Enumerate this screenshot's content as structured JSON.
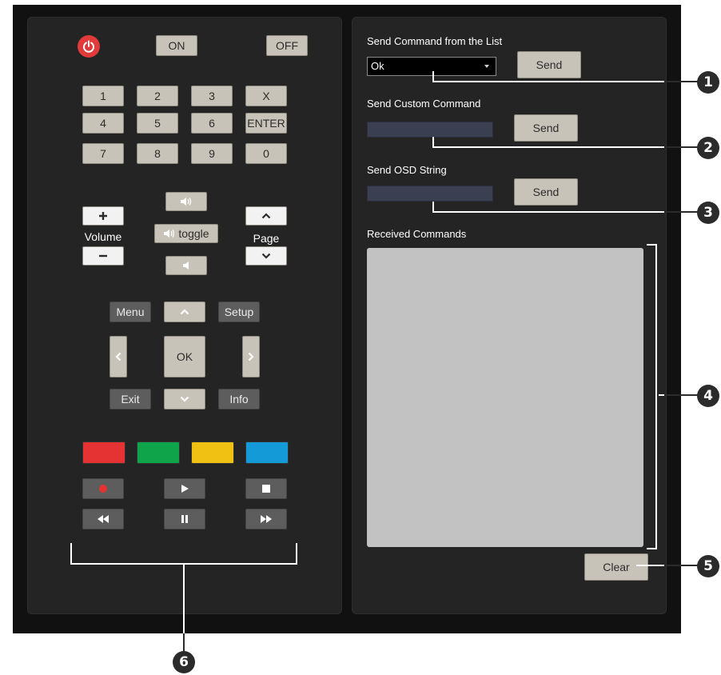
{
  "remote": {
    "power_icon": "power-icon",
    "on_label": "ON",
    "off_label": "OFF",
    "keypad": [
      "1",
      "2",
      "3",
      "X",
      "4",
      "5",
      "6",
      "ENTER",
      "7",
      "8",
      "9",
      "0"
    ],
    "volume_label": "Volume",
    "volume_up_icon": "plus-icon",
    "volume_down_icon": "minus-icon",
    "speaker_up_icon": "speaker-loud-icon",
    "toggle_label": "toggle",
    "speaker_down_icon": "speaker-quiet-icon",
    "page_label": "Page",
    "menu_label": "Menu",
    "setup_label": "Setup",
    "ok_label": "OK",
    "exit_label": "Exit",
    "info_label": "Info",
    "color_buttons": [
      "#e53333",
      "#0fa34a",
      "#f0c012",
      "#149ad6"
    ],
    "media_icons": [
      "record-icon",
      "play-icon",
      "stop-icon",
      "rewind-icon",
      "pause-icon",
      "fast-forward-icon"
    ]
  },
  "commands": {
    "list_title": "Send Command from the List",
    "list_selected": "Ok",
    "send_label": "Send",
    "custom_title": "Send Custom Command",
    "osd_title": "Send OSD String",
    "received_title": "Received Commands",
    "clear_label": "Clear"
  },
  "callouts": [
    "1",
    "2",
    "3",
    "4",
    "5",
    "6"
  ]
}
